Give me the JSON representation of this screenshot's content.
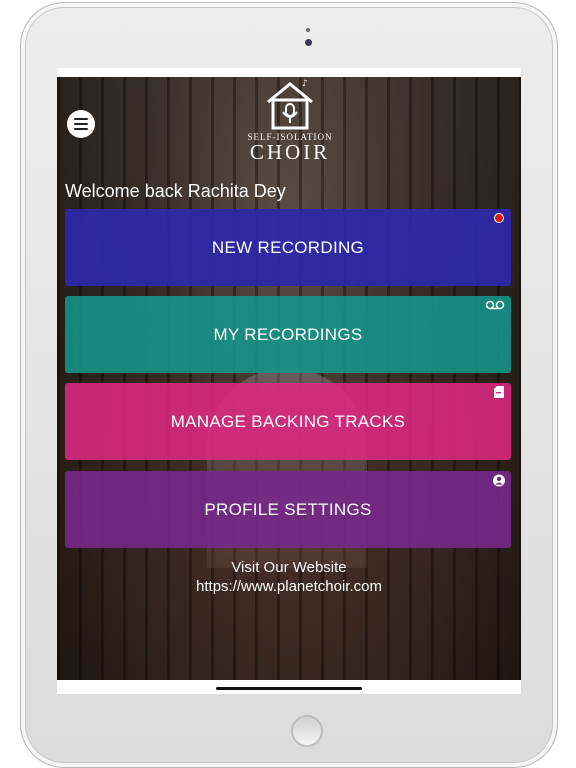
{
  "app": {
    "logo_line1": "SELF-ISOLATION",
    "logo_line2": "CHOIR",
    "welcome": "Welcome back Rachita Dey"
  },
  "menu": {
    "icon": "hamburger-menu-icon"
  },
  "tiles": [
    {
      "label": "NEW RECORDING",
      "icon": "record-dot-icon",
      "color": "#2c28aa"
    },
    {
      "label": "MY RECORDINGS",
      "icon": "voicemail-icon",
      "color": "#14968c"
    },
    {
      "label": "MANAGE BACKING TRACKS",
      "icon": "document-icon",
      "color": "#dc2882"
    },
    {
      "label": "PROFILE SETTINGS",
      "icon": "user-circle-icon",
      "color": "#78288c"
    }
  ],
  "footer": {
    "title": "Visit Our Website",
    "url": "https://www.planetchoir.com"
  },
  "colors": {
    "record_dot": "#d61a1a",
    "text": "#ffffff"
  }
}
